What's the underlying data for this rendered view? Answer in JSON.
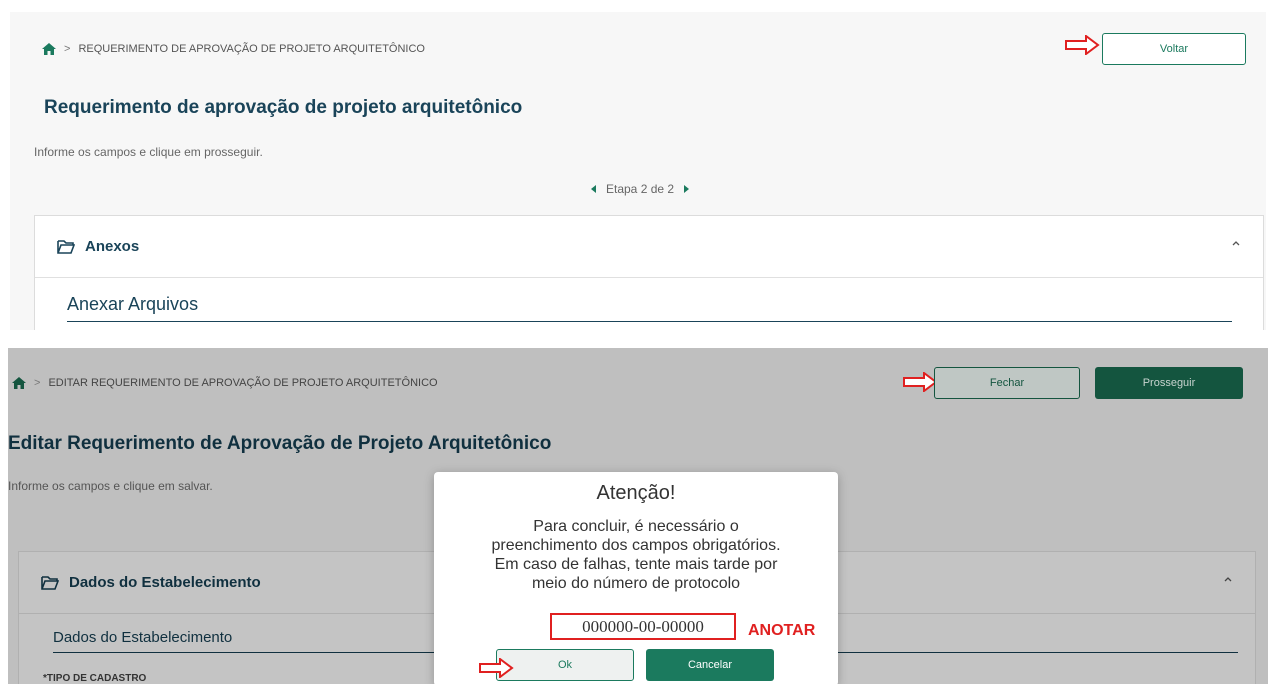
{
  "screen1": {
    "breadcrumb": {
      "separator": ">",
      "text": "REQUERIMENTO DE APROVAÇÃO DE PROJETO ARQUITETÔNICO"
    },
    "back_button": "Voltar",
    "title": "Requerimento de aprovação de projeto arquitetônico",
    "subtitle": "Informe os campos e clique em prosseguir.",
    "step": "Etapa 2 de 2",
    "panel": {
      "label": "Anexos",
      "section_title": "Anexar Arquivos"
    }
  },
  "screen2": {
    "breadcrumb": {
      "separator": ">",
      "text": "EDITAR REQUERIMENTO DE APROVAÇÃO DE PROJETO ARQUITETÔNICO"
    },
    "close_button": "Fechar",
    "proceed_button": "Prosseguir",
    "title": "Editar Requerimento de Aprovação de Projeto Arquitetônico",
    "subtitle": "Informe os campos e clique em salvar.",
    "panel": {
      "label": "Dados do Estabelecimento",
      "section_title": "Dados do Estabelecimento",
      "field_label": "*TIPO DE CADASTRO"
    },
    "modal": {
      "title": "Atenção!",
      "line1": "Para concluir, é necessário o",
      "line2": "preenchimento dos campos obrigatórios.",
      "line3": "Em caso de falhas, tente mais tarde por",
      "line4": "meio do número de protocolo",
      "protocol": "000000-00-00000",
      "note": "ANOTAR",
      "ok_button": "Ok",
      "cancel_button": "Cancelar"
    }
  },
  "colors": {
    "brand_green": "#1b7a5e",
    "title_blue": "#1a4459",
    "annotation_red": "#e02020"
  },
  "icons": [
    "home-icon",
    "folder-icon",
    "chevron-up-icon",
    "chevron-left-icon",
    "chevron-right-icon",
    "red-arrow-icon"
  ]
}
